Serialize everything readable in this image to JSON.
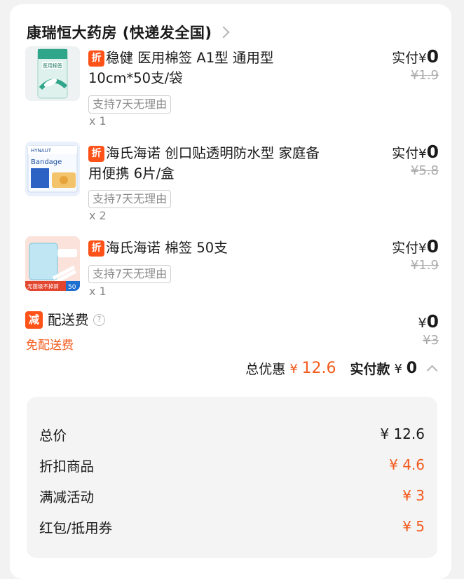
{
  "store": {
    "name": "康瑞恒大药房 (快递发全国)"
  },
  "items": [
    {
      "tag": "折",
      "title": "稳健 医用棉签 A1型 通用型 10cm*50支/袋",
      "return_policy": "支持7天无理由",
      "qty": "x 1",
      "paid_label": "实付",
      "paid_currency": "¥",
      "paid_value": "0",
      "original_price": "¥1.9",
      "thumb_text": "医用棉签"
    },
    {
      "tag": "折",
      "title": "海氏海诺 创口贴透明防水型 家庭备用便携 6片/盒",
      "return_policy": "支持7天无理由",
      "qty": "x 2",
      "paid_label": "实付",
      "paid_currency": "¥",
      "paid_value": "0",
      "original_price": "¥5.8",
      "thumb_text": "Bandage"
    },
    {
      "tag": "折",
      "title": "海氏海诺 棉签 50支",
      "return_policy": "支持7天无理由",
      "qty": "x 1",
      "paid_label": "实付",
      "paid_currency": "¥",
      "paid_value": "0",
      "original_price": "¥1.9",
      "thumb_text": "无菌级不掉屑"
    }
  ],
  "shipping": {
    "tag": "减",
    "label": "配送费",
    "help_icon": "?",
    "note": "免配送费",
    "paid_currency": "¥",
    "paid_value": "0",
    "original_price": "¥3"
  },
  "summary": {
    "discount_label": "总优惠",
    "discount_currency": "¥",
    "discount_value": "12.6",
    "paid_label": "实付款",
    "paid_currency": "¥",
    "paid_value": "0"
  },
  "breakdown": [
    {
      "label": "总价",
      "value": "¥ 12.6"
    },
    {
      "label": "折扣商品",
      "value": "¥ 4.6"
    },
    {
      "label": "满减活动",
      "value": "¥ 3"
    },
    {
      "label": "红包/抵用券",
      "value": "¥ 5"
    }
  ],
  "colors": {
    "accent": "#ff5219",
    "discount_text": "#f45a1c",
    "muted": "#aaaaaa"
  },
  "icons": {
    "store_chevron": "chevron-right-icon",
    "summary_toggle": "chevron-up-icon"
  }
}
